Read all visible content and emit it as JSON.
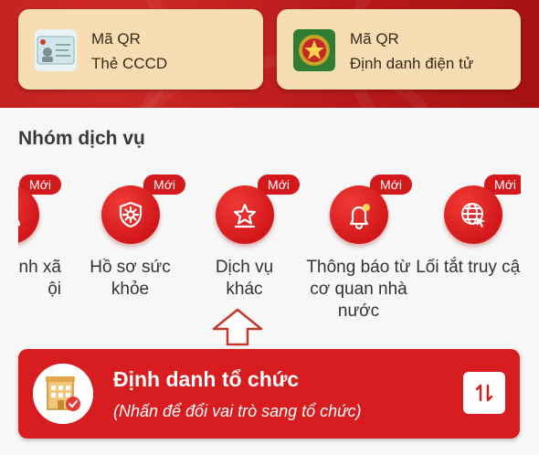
{
  "qr_cards": [
    {
      "line1": "Mã QR",
      "line2": "Thẻ CCCD",
      "icon": "id-card-icon"
    },
    {
      "line1": "Mã QR",
      "line2": "Định danh điện tử",
      "icon": "police-emblem-icon"
    }
  ],
  "services": {
    "title": "Nhóm dịch vụ",
    "items": [
      {
        "label": "Nhóm xã hội",
        "visible_label": "nh xã\nội",
        "badge": "Mới",
        "icon": "social-group-icon"
      },
      {
        "label": "Hồ sơ sức khỏe",
        "badge": "Mới",
        "icon": "virus-shield-icon"
      },
      {
        "label": "Dịch vụ khác",
        "badge": "Mới",
        "icon": "star-service-icon"
      },
      {
        "label": "Thông báo từ cơ quan nhà nước",
        "badge": "Mới",
        "icon": "bell-icon"
      },
      {
        "label": "Lối tắt truy cập",
        "badge": "Mới",
        "icon": "globe-cursor-icon"
      }
    ]
  },
  "organization": {
    "title": "Định danh tổ chức",
    "subtitle": "(Nhấn để đổi vai trò sang tổ chức)",
    "icon": "building-icon",
    "switch_icon": "swap-vertical-icon"
  },
  "colors": {
    "brand_red": "#d81d20",
    "card_beige": "#f6ddb3"
  }
}
